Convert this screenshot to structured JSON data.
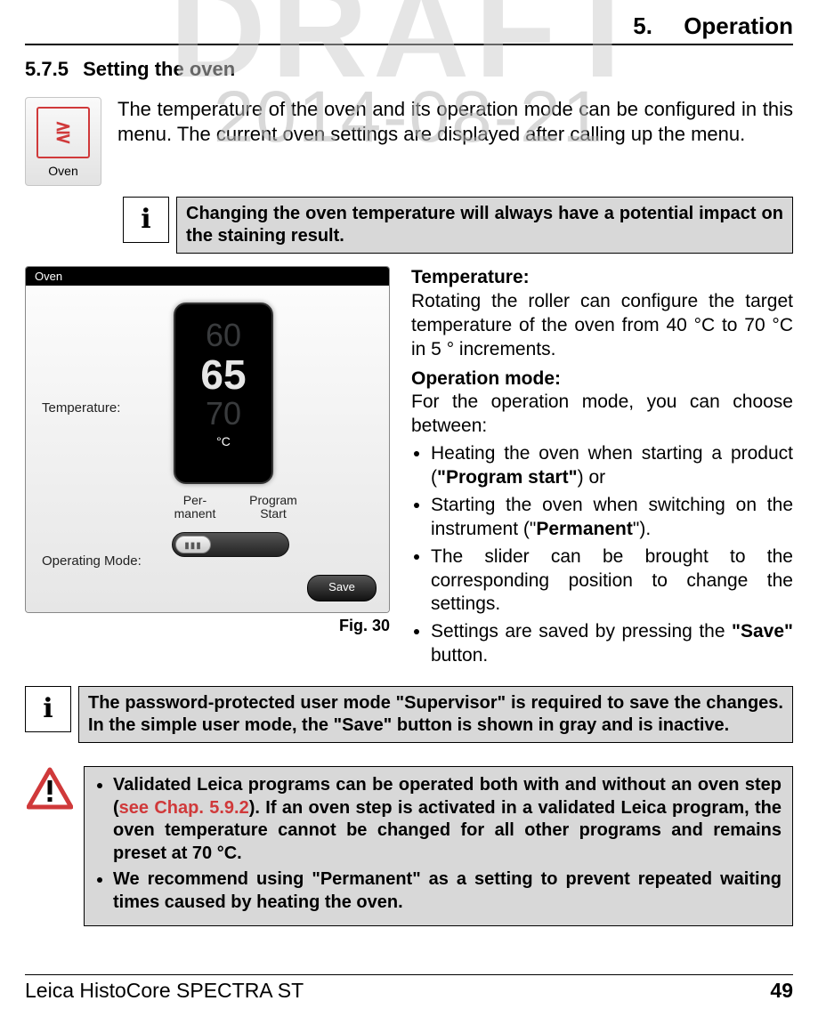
{
  "watermark": {
    "large": "DRAFT",
    "date": "2014-08-21"
  },
  "header": {
    "chapter_num": "5.",
    "chapter_title": "Operation"
  },
  "section": {
    "number": "5.7.5",
    "title": "Setting the oven"
  },
  "oven_icon": {
    "glyph": "⋛",
    "label": "Oven"
  },
  "intro": "The temperature of the oven and its operation mode can be configured in this menu. The current oven settings are displayed after calling up the menu.",
  "note1": "Changing the oven temperature will always have a potential impact on the staining result.",
  "figure": {
    "title": "Oven",
    "temp_label": "Temperature:",
    "opmode_label": "Operating Mode:",
    "temp_prev": "60",
    "temp_current": "65",
    "temp_next": "70",
    "temp_unit": "°C",
    "mode_left_line1": "Per-",
    "mode_left_line2": "manent",
    "mode_right_line1": "Program",
    "mode_right_line2": "Start",
    "save_label": "Save",
    "caption": "Fig. 30"
  },
  "right": {
    "temp_head": "Temperature:",
    "temp_body": "Rotating the roller can configure the target temperature of the oven from 40 °C to 70 °C in 5 ° increments.",
    "op_head": "Operation mode:",
    "op_intro": "For the operation mode, you can choose between:",
    "b1a": "Heating the oven when starting a product (",
    "b1b": "\"Program start\"",
    "b1c": ") or",
    "b2a": "Starting the oven when switching on the instrument (\"",
    "b2b": "Permanent",
    "b2c": "\").",
    "b3": "The slider can be brought to the corresponding position to change the settings.",
    "b4a": "Settings are saved by pressing the ",
    "b4b": "\"Save\"",
    "b4c": " button."
  },
  "note2": "The password-protected user mode \"Supervisor\" is required to save the changes. In the simple user mode, the \"Save\" button is shown in gray and is inactive.",
  "warning": {
    "b1a": "Validated Leica programs can be operated both with and without an oven step (",
    "b1link": "see Chap. 5.9.2",
    "b1b": "). If an oven step is activated in a validated Leica program, the oven temperature cannot be changed for all other programs and remains preset at 70 °C.",
    "b2": "We recommend using \"Permanent\" as a setting to prevent repeated waiting times caused by heating the oven."
  },
  "footer": {
    "product": "Leica HistoCore SPECTRA ST",
    "page": "49"
  }
}
